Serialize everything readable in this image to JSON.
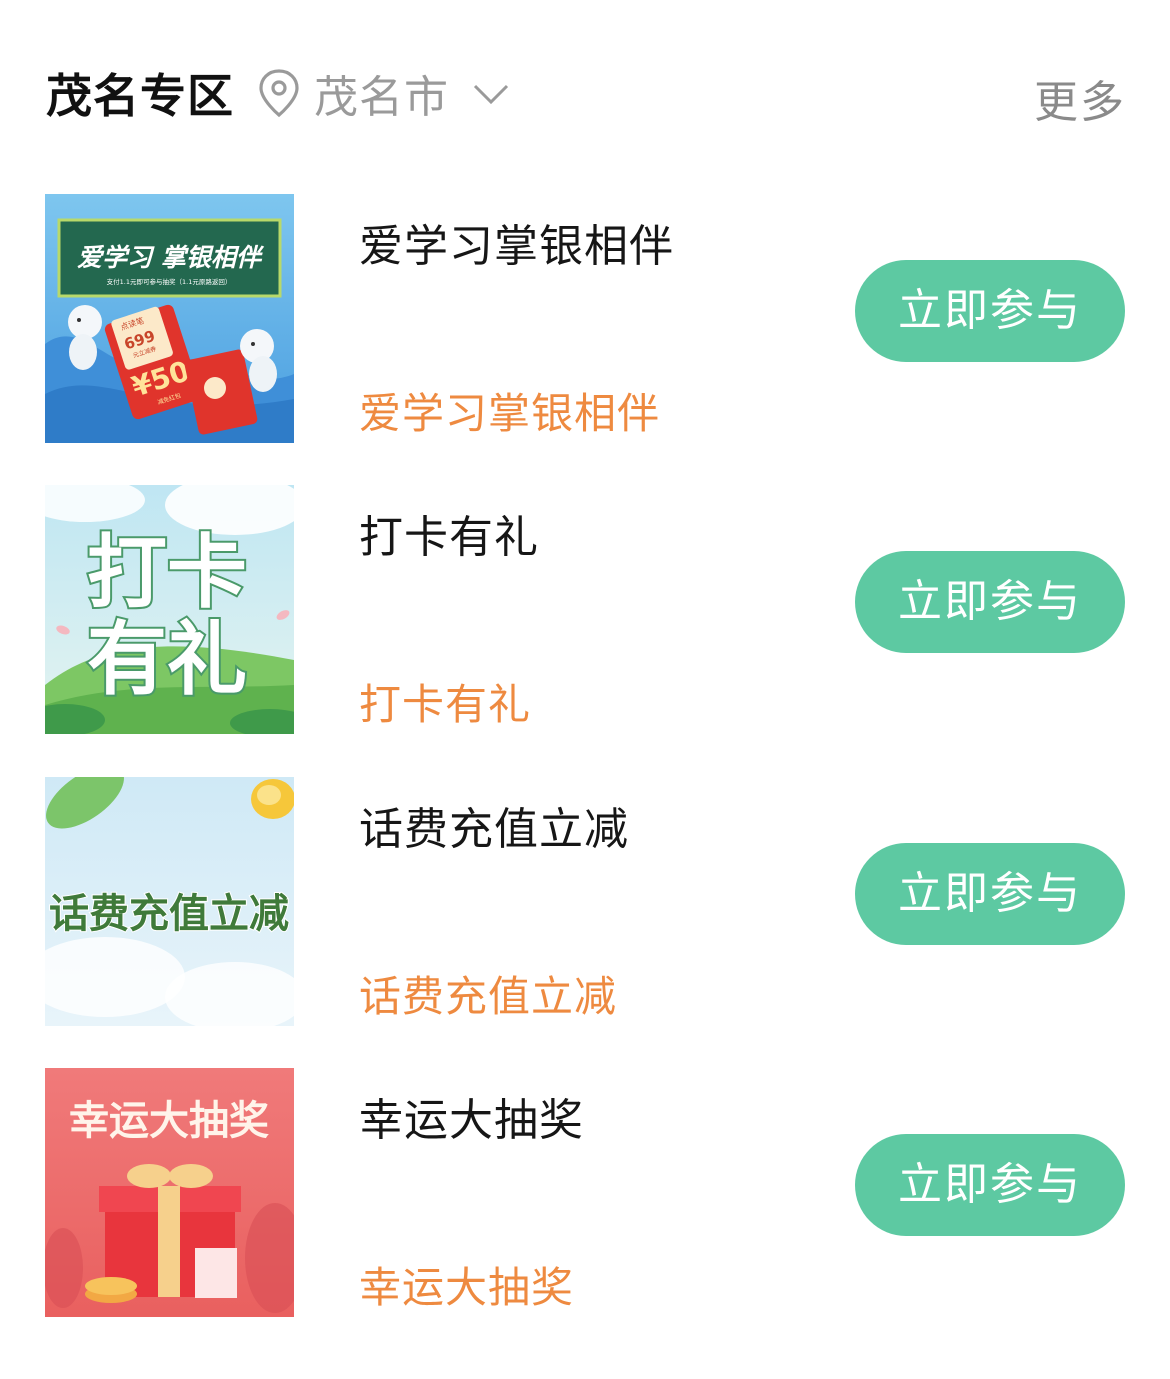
{
  "header": {
    "title": "茂名专区",
    "city": "茂名市",
    "more": "更多",
    "location_icon": "location-pin-icon",
    "dropdown_icon": "chevron-down-icon"
  },
  "colors": {
    "accent_green": "#5dc9a2",
    "subtitle_orange": "#ee8a40",
    "muted_gray": "#9a9a9a"
  },
  "activities": [
    {
      "name": "爱学习掌银相伴",
      "subtitle": "爱学习掌银相伴",
      "button": "立即参与",
      "banner": {
        "title": "爱学习 掌银相伴",
        "caption": "支付1.1元即可参与抽奖（1.1元原路返回）",
        "coupon_label": "点读笔",
        "coupon_value": "699",
        "coupon_note": "元立减券",
        "red_packet": "¥50",
        "red_packet_note": "减免红包"
      }
    },
    {
      "name": "打卡有礼",
      "subtitle": "打卡有礼",
      "button": "立即参与",
      "banner": {
        "line1": "打卡",
        "line2": "有礼"
      }
    },
    {
      "name": "话费充值立减",
      "subtitle": "话费充值立减",
      "button": "立即参与",
      "banner": {
        "title": "话费充值立减"
      }
    },
    {
      "name": "幸运大抽奖",
      "subtitle": "幸运大抽奖",
      "button": "立即参与",
      "banner": {
        "title": "幸运大抽奖"
      }
    }
  ]
}
